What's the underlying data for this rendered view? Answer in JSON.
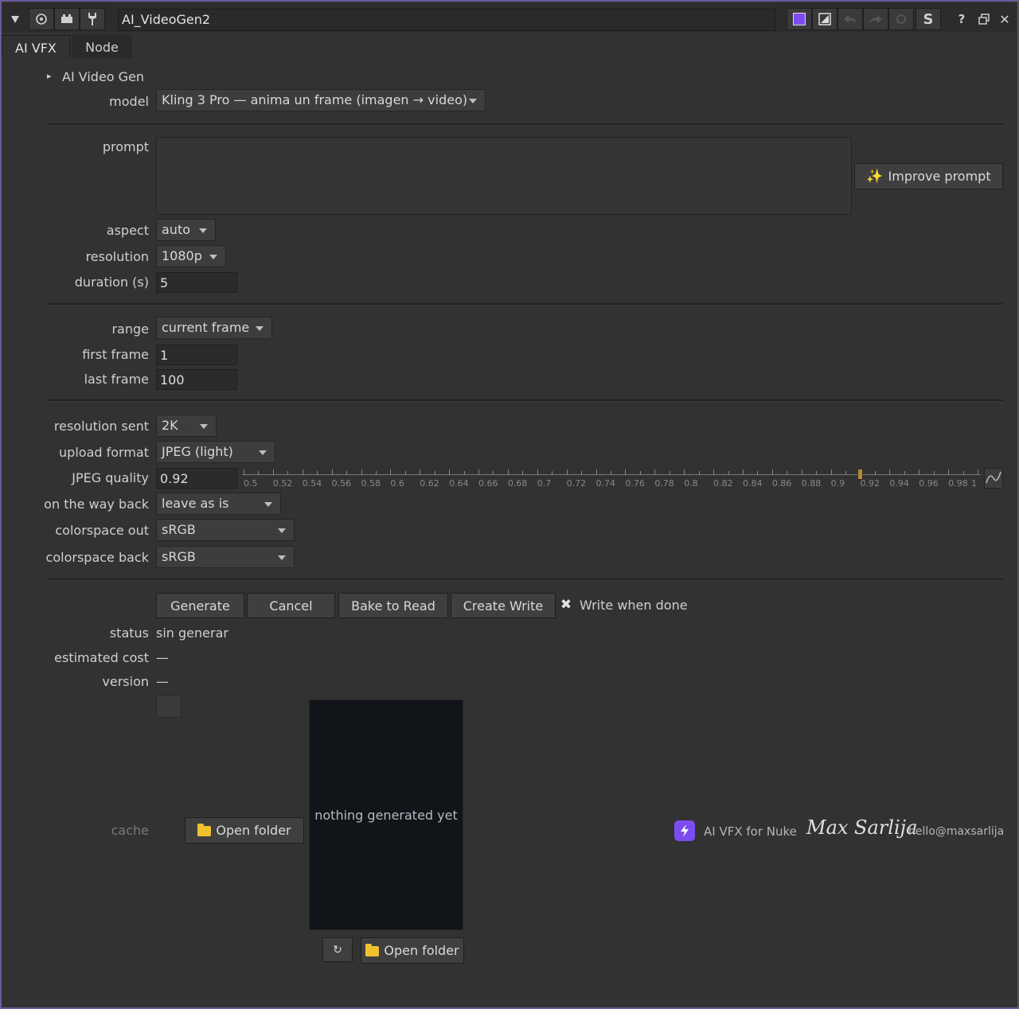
{
  "window": {
    "node_name": "AI_VideoGen2"
  },
  "toolbar_icons": [
    "collapse-icon",
    "circle-icon",
    "node-icon",
    "wrench-icon",
    "color-swatch-icon",
    "edit-icon",
    "undo-icon",
    "redo-icon",
    "revert-icon",
    "s-icon",
    "help-icon",
    "float-icon",
    "close-icon"
  ],
  "toolbar": {
    "s_label": "S",
    "help_label": "?",
    "close_label": "✕"
  },
  "tabs": [
    {
      "label": "AI VFX"
    },
    {
      "label": "Node"
    }
  ],
  "section": {
    "title": "AI Video Gen",
    "toggle": "▸"
  },
  "model": {
    "label": "model",
    "value": "Kling 3 Pro — anima un frame (imagen → video)"
  },
  "prompt": {
    "label": "prompt",
    "value": ""
  },
  "improve_prompt": {
    "label": "Improve prompt"
  },
  "aspect": {
    "label": "aspect",
    "value": "auto"
  },
  "resolution": {
    "label": "resolution",
    "value": "1080p"
  },
  "duration": {
    "label": "duration (s)",
    "value": "5"
  },
  "range": {
    "label": "range",
    "value": "current frame"
  },
  "first_frame": {
    "label": "first frame",
    "value": "1"
  },
  "last_frame": {
    "label": "last frame",
    "value": "100"
  },
  "resolution_sent": {
    "label": "resolution sent",
    "value": "2K"
  },
  "upload_format": {
    "label": "upload format",
    "value": "JPEG (light)"
  },
  "jpeg_quality": {
    "label": "JPEG quality",
    "value": "0.92",
    "slider_min": 0.5,
    "slider_max": 1,
    "slider_value": 0.92,
    "ticks": [
      "0.5",
      "0.52",
      "0.54",
      "0.56",
      "0.58",
      "0.6",
      "0.62",
      "0.64",
      "0.66",
      "0.68",
      "0.7",
      "0.72",
      "0.74",
      "0.76",
      "0.78",
      "0.8",
      "0.82",
      "0.84",
      "0.86",
      "0.88",
      "0.9",
      "0.92",
      "0.94",
      "0.96",
      "0.98",
      "1"
    ]
  },
  "on_the_way_back": {
    "label": "on the way back",
    "value": "leave as is"
  },
  "colorspace_out": {
    "label": "colorspace out",
    "value": "sRGB"
  },
  "colorspace_back": {
    "label": "colorspace back",
    "value": "sRGB"
  },
  "actions": {
    "generate": "Generate",
    "cancel": "Cancel",
    "bake": "Bake to Read",
    "create_write": "Create Write",
    "write_when_done": "Write when done",
    "write_when_done_checked": true
  },
  "status": {
    "label": "status",
    "value": "sin generar"
  },
  "estimated_cost": {
    "label": "estimated cost",
    "value": "—"
  },
  "version": {
    "label": "version",
    "value": "—"
  },
  "cache": {
    "label": "cache",
    "open_folder": "Open folder"
  },
  "preview": {
    "placeholder": "nothing generated yet",
    "refresh": "↻",
    "open_folder": "Open folder"
  },
  "footer": {
    "product": "AI VFX for Nuke",
    "signature": "Max Sarlija",
    "email": "hello@maxsarlija"
  },
  "colors": {
    "accent": "#6c5a9c",
    "bg": "#323232",
    "preview_bg": "#111418",
    "badge": "#7b4cf0"
  }
}
